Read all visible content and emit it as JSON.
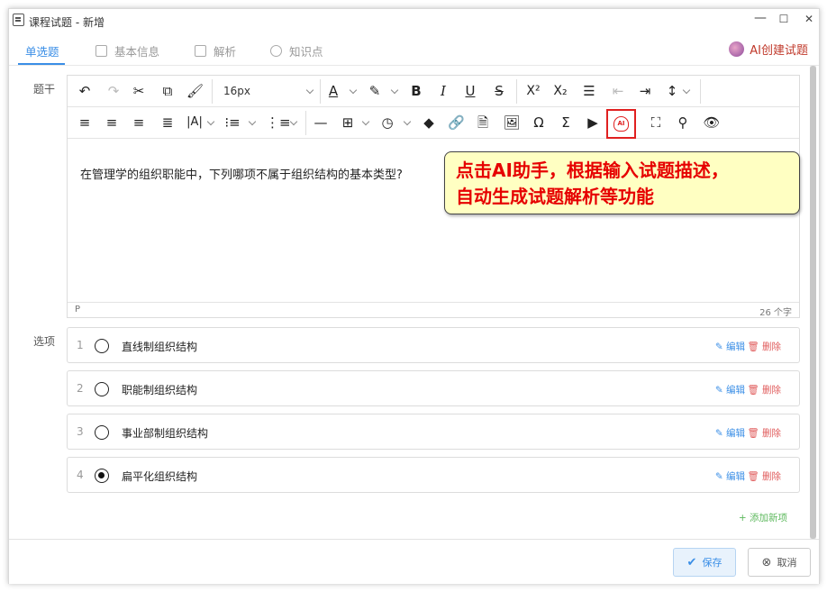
{
  "window": {
    "title": "课程试题 - 新增",
    "controls": {
      "minimize": "—",
      "maximize": "☐",
      "close": "✕"
    }
  },
  "tabs": [
    {
      "label": "单选题"
    },
    {
      "label": "基本信息"
    },
    {
      "label": "解析"
    },
    {
      "label": "知识点"
    }
  ],
  "ai_create_label": "AI创建试题",
  "labels": {
    "stem": "题干",
    "options": "选项"
  },
  "toolbar": {
    "font_size": "16px",
    "superscript": "X²",
    "subscript": "X₂",
    "omega": "Ω",
    "sigma": "Σ",
    "ai_text": "AI"
  },
  "editor": {
    "content": "在管理学的组织职能中，下列哪项不属于组织结构的基本类型?",
    "status_tag": "P",
    "char_count": "26 个字"
  },
  "callout": {
    "line1": "点击AI助手，根据输入试题描述，",
    "line2": "自动生成试题解析等功能"
  },
  "options": [
    {
      "num": "1",
      "text": "直线制组织结构",
      "selected": false
    },
    {
      "num": "2",
      "text": "职能制组织结构",
      "selected": false
    },
    {
      "num": "3",
      "text": "事业部制组织结构",
      "selected": false
    },
    {
      "num": "4",
      "text": "扁平化组织结构",
      "selected": true
    }
  ],
  "option_actions": {
    "edit": "编辑",
    "delete": "删除"
  },
  "add_new": "+ 添加新项",
  "footer": {
    "save": "保存",
    "cancel": "取消"
  },
  "colors": {
    "accent": "#3a8ee6",
    "danger": "#e02020",
    "callout_bg": "#ffffc2"
  }
}
